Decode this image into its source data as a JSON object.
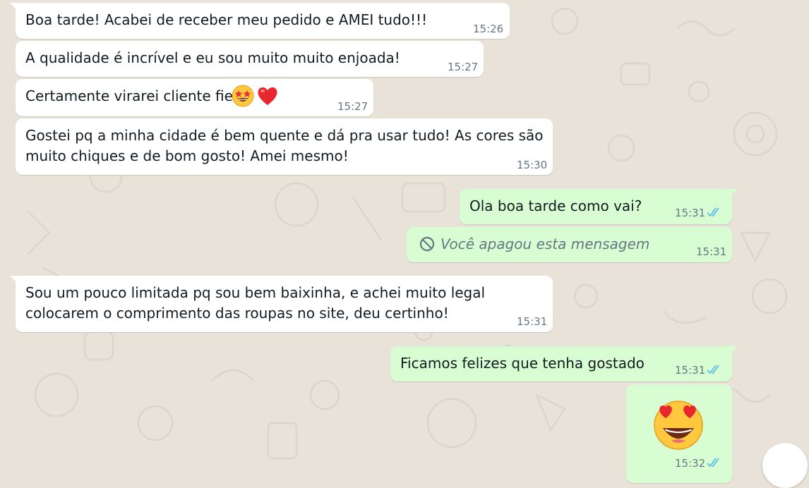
{
  "chat": {
    "messages": [
      {
        "text": "Boa tarde! Acabei de receber meu pedido e AMEI tudo!!!",
        "time": "15:26"
      },
      {
        "text": "A qualidade é incrível e eu sou muito muito enjoada!",
        "time": "15:27"
      },
      {
        "text": "Certamente virarei cliente fiel",
        "emojis": [
          "star-struck-face",
          "red-heart"
        ],
        "time": "15:27"
      },
      {
        "line1": "Gostei pq a minha cidade é bem quente e dá pra usar tudo! As cores são",
        "line2": "muito chiques e de bom gosto! Amei mesmo!",
        "time": "15:30"
      },
      {
        "text": "Ola boa tarde como vai?",
        "time": "15:31",
        "status": "read"
      },
      {
        "text": "Você apagou esta mensagem",
        "time": "15:31"
      },
      {
        "line1": "Sou um pouco limitada pq sou bem baixinha, e achei muito legal",
        "line2": "colocarem o comprimento das roupas no site, deu certinho!",
        "time": "15:31"
      },
      {
        "text": "Ficamos felizes que tenha gostado",
        "time": "15:31",
        "status": "read"
      },
      {
        "emoji": "heart-eyes-face",
        "time": "15:32",
        "status": "read"
      }
    ]
  },
  "colors": {
    "background": "#e9e2d9",
    "incoming": "#ffffff",
    "outgoing": "#d9fdd3",
    "tick_read": "#53bdeb",
    "timestamp": "#667781"
  }
}
